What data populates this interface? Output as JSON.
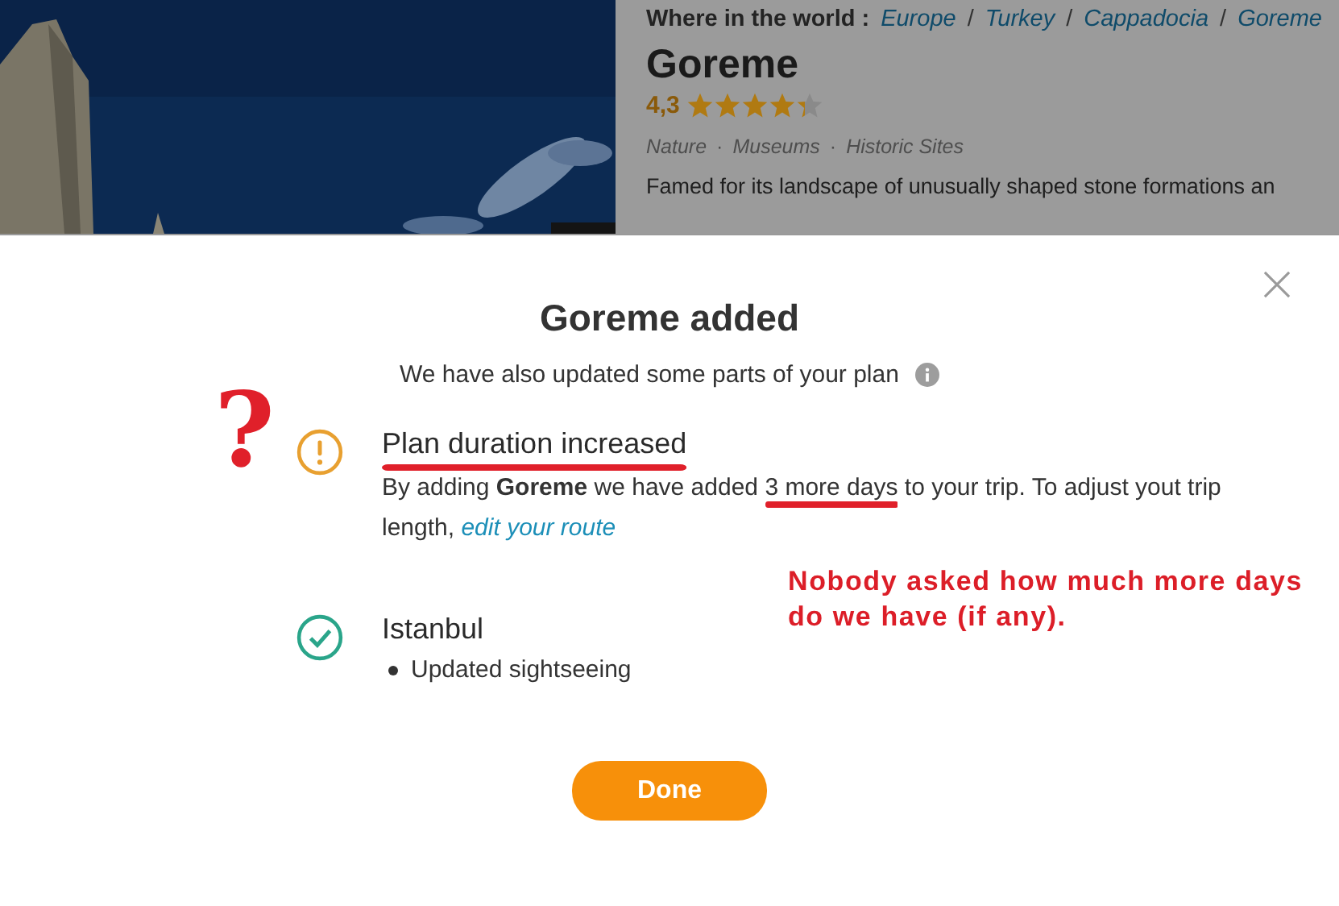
{
  "place_page": {
    "breadcrumb_label": "Where in the world :",
    "breadcrumb": [
      "Europe",
      "Turkey",
      "Cappadocia",
      "Goreme"
    ],
    "breadcrumb_separator": "/",
    "tag_separator": "·",
    "title": "Goreme",
    "rating": "4,3",
    "stars": 4.3,
    "tags": [
      "Nature",
      "Museums",
      "Historic Sites"
    ],
    "description": "Famed for its landscape of unusually shaped stone formations an"
  },
  "dialog": {
    "title": "Goreme added",
    "subtitle": "We have also updated some parts of your plan",
    "updates": [
      {
        "kind": "warning",
        "title": "Plan duration increased",
        "text": "By adding **Goreme** we have added ",
        "highlight": "3 more days",
        "text_after": " to your trip. To adjust yout trip length, ",
        "link": "edit your route"
      },
      {
        "kind": "success",
        "title": "Istanbul",
        "bullets": [
          "Updated sightseeing"
        ]
      }
    ],
    "button": "Done"
  },
  "annotations": {
    "mark": "?",
    "note": "Nobody asked how much more days do we have (if any)."
  }
}
